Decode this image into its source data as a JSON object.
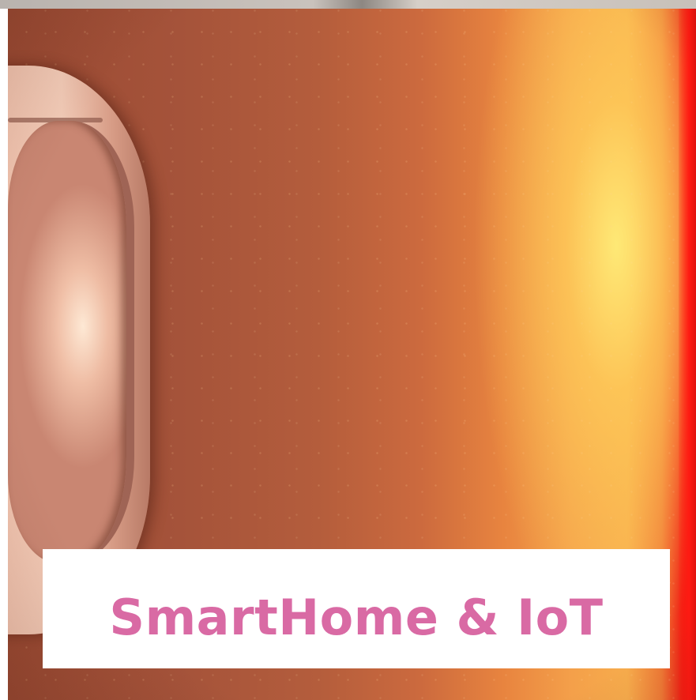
{
  "card": {
    "title": "SmartHome & IoT",
    "title_color": "#d96aa4",
    "image_subject": "motion-sensor-photo"
  }
}
